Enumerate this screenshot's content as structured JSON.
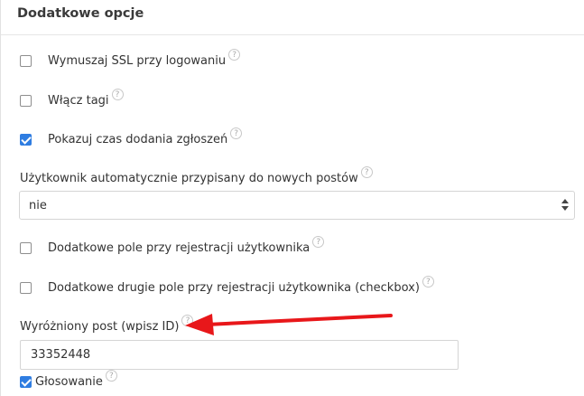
{
  "section": {
    "title": "Dodatkowe opcje"
  },
  "help_glyph": "?",
  "options": {
    "force_ssl": {
      "label": "Wymuszaj SSL przy logowaniu",
      "checked": false
    },
    "enable_tags": {
      "label": "Włącz tagi",
      "checked": false
    },
    "show_submission_time": {
      "label": "Pokazuj czas dodania zgłoszeń",
      "checked": true
    },
    "auto_assigned_user": {
      "label": "Użytkownik automatycznie przypisany do nowych postów",
      "selected": "nie"
    },
    "extra_registration_field": {
      "label": "Dodatkowe pole przy rejestracji użytkownika",
      "checked": false
    },
    "extra_second_registration_field": {
      "label": "Dodatkowe drugie pole przy rejestracji użytkownika (checkbox)",
      "checked": false
    },
    "featured_post": {
      "label": "Wyróżniony post (wpisz ID)",
      "value": "33352448"
    },
    "voting": {
      "label": "Głosowanie",
      "checked": true
    }
  },
  "colors": {
    "checkbox_checked": "#2f7de1",
    "annotation_arrow": "#e8171a"
  }
}
